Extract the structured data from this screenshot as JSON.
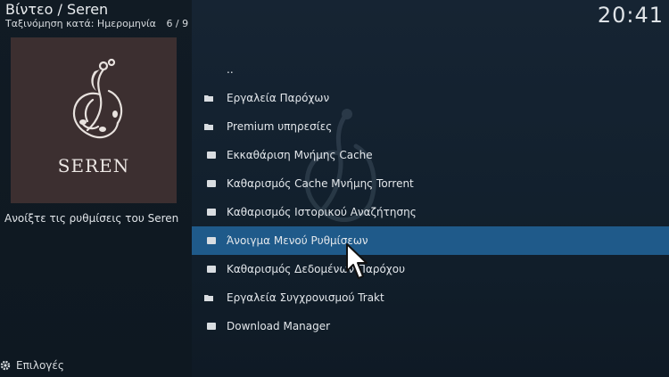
{
  "header": {
    "title": "Βίντεο / Seren",
    "sort_label": "Ταξινόμηση κατά: Ημερομηνία",
    "count": "6 / 9",
    "clock": "20:41"
  },
  "poster": {
    "logo_text": "SEREN"
  },
  "description": "Ανοίξτε τις ρυθμίσεις του Seren",
  "footer": {
    "options_label": "Επιλογές"
  },
  "list": {
    "parent": "..",
    "items": [
      {
        "label": "Εργαλεία Παρόχων",
        "icon": "folder-icon"
      },
      {
        "label": "Premium υπηρεσίες",
        "icon": "folder-icon"
      },
      {
        "label": "Εκκαθάριση Μνήμης Cache",
        "icon": "file-icon"
      },
      {
        "label": "Καθαρισμός Cache Μνήμης Torrent",
        "icon": "file-icon"
      },
      {
        "label": "Καθαρισμός Ιστορικού Αναζήτησης",
        "icon": "file-icon"
      },
      {
        "label": "Άνοιγμα Μενού Ρυθμίσεων",
        "icon": "file-icon",
        "selected": true
      },
      {
        "label": "Καθαρισμός Δεδομένων Παρόχου",
        "icon": "file-icon"
      },
      {
        "label": "Εργαλεία Συγχρονισμού Trakt",
        "icon": "folder-icon"
      },
      {
        "label": "Download Manager",
        "icon": "file-icon"
      }
    ]
  },
  "colors": {
    "selection": "#1f5a8a",
    "poster_bg": "#3c2f30"
  }
}
